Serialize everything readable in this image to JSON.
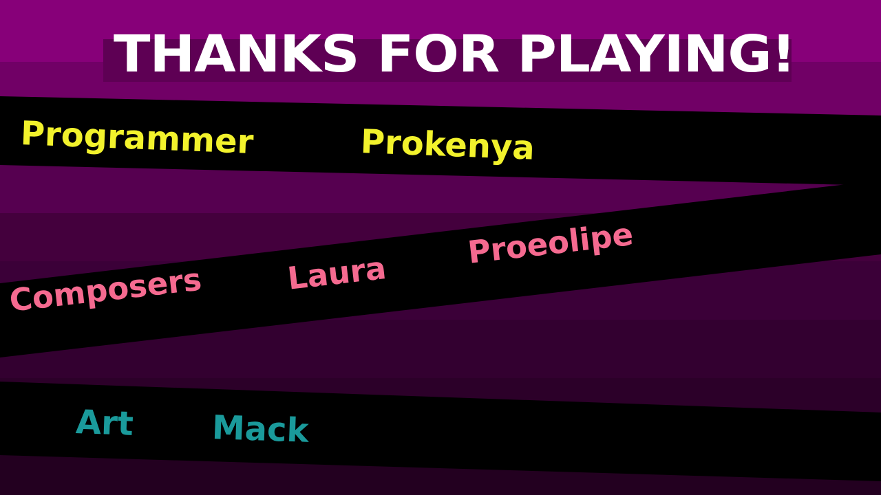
{
  "screen": {
    "title": "THANKS FOR PLAYING!"
  },
  "credits": {
    "programmer": {
      "role": "Programmer",
      "names": [
        "Prokenya"
      ]
    },
    "composers": {
      "role": "Composers",
      "names": [
        "Laura",
        "Proeolipe"
      ]
    },
    "art": {
      "role": "Art",
      "names": [
        "Mack"
      ]
    }
  },
  "colors": {
    "background_top": "#870079",
    "background_bottom": "#230020",
    "stripe": "#000000",
    "title": "#ffffff",
    "programmer_text": "#f2f22c",
    "composers_text": "#f56a90",
    "art_text": "#1a9a9b"
  }
}
